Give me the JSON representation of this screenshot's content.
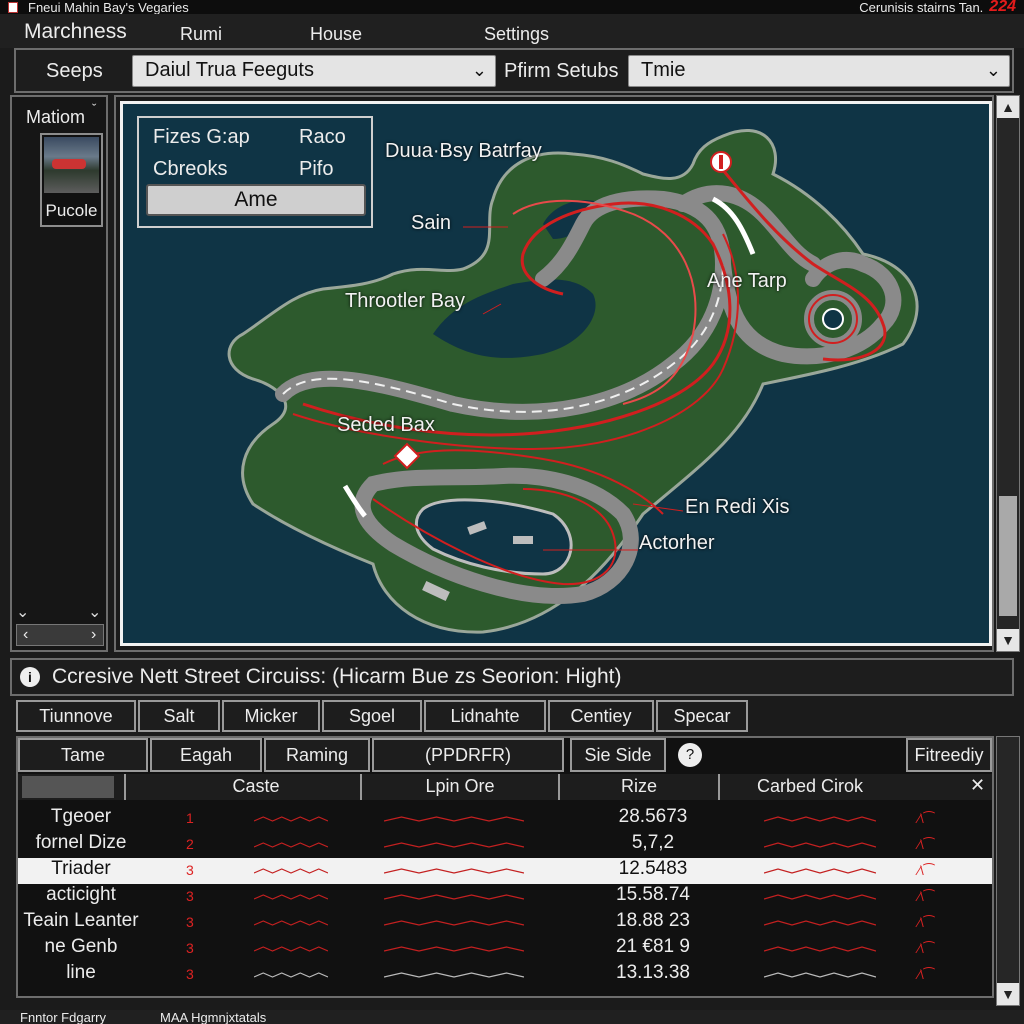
{
  "window": {
    "title": "Fneui Mahin Bay's Vegaries",
    "right_text": "Cerunisis stairns Tan.",
    "brand": "224"
  },
  "menu": {
    "items": [
      "Marchness",
      "Rumi",
      "House",
      "Settings"
    ]
  },
  "toolbar": {
    "seeps_label": "Seeps",
    "feed_select_value": "Daiul Trua Feeguts",
    "setups_label": "Pfirm Setubs",
    "time_select_value": "Tmie"
  },
  "sidebar": {
    "title": "Matiom",
    "thumb_caption": "Pucole"
  },
  "map": {
    "legend": {
      "left1": "Fizes G:ap",
      "right1": "Raco",
      "left2": "Cbreoks",
      "right2": "Pifo",
      "button": "Ame"
    },
    "labels": {
      "bay_top": "Duua·Bsy Batrfay",
      "sain": "Sain",
      "throttler": "Throotler Bay",
      "ane_tarp": "Ane Tarp",
      "seded": "Seded Bax",
      "en_redi": "En Redi Xis",
      "actorher": "Actorher"
    },
    "colors": {
      "water": "#0f3445",
      "land": "#2d5a2d",
      "track": "#8a8a8a",
      "racing_line": "#d11f1f"
    }
  },
  "info": {
    "text": "Ccresive Nett Street Circuiss: (Hicarm Bue zs Seorion: Hight)"
  },
  "tabs": [
    "Tiunnove",
    "Salt",
    "Micker",
    "Sgoel",
    "Lidnahte",
    "Centiey",
    "Specar"
  ],
  "table": {
    "header1": [
      "Tame",
      "Eagah",
      "Raming",
      "(PPDRFR)",
      "Sie Side",
      "Fitreediy"
    ],
    "header2": [
      "Caste",
      "Lpin Ore",
      "Rize",
      "Carbed Cirok"
    ],
    "close_glyph": "✕",
    "help_glyph": "?",
    "rows": [
      {
        "name": "Tgeoer",
        "num": "1",
        "value": "28.5673"
      },
      {
        "name": "fornel Dize",
        "num": "2",
        "value": "5,7,2"
      },
      {
        "name": "Triader",
        "num": "3",
        "value": "12.5483",
        "selected": true
      },
      {
        "name": "acticight",
        "num": "3",
        "value": "15.58.74"
      },
      {
        "name": "Teain Leanter",
        "num": "3",
        "value": "18.88 23"
      },
      {
        "name": "ne Genb",
        "num": "3",
        "value": "21 €81 9"
      },
      {
        "name": "line",
        "num": "3",
        "value": "13.13.38"
      }
    ]
  },
  "status": {
    "left": "Fnntor Fdgarry",
    "right": "MAA Hgmnjxtatals"
  }
}
